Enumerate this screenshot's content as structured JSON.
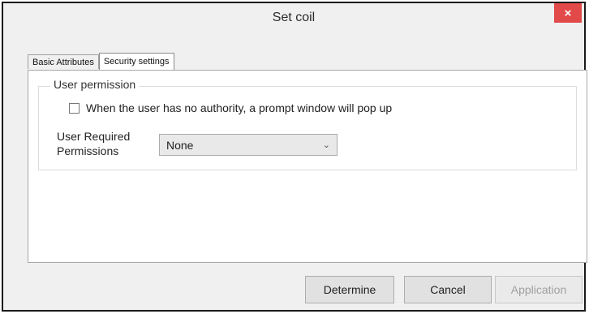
{
  "window": {
    "title": "Set coil",
    "close_symbol": "×"
  },
  "tabs": [
    {
      "label": "Basic Attributes",
      "active": false
    },
    {
      "label": "Security settings",
      "active": true
    }
  ],
  "security": {
    "group_title": "User permission",
    "checkbox": {
      "label": "When the user has no authority, a prompt window will pop up",
      "checked": false
    },
    "required_permissions": {
      "label": "User Required Permissions",
      "value": "None"
    }
  },
  "buttons": {
    "determine": "Determine",
    "cancel": "Cancel",
    "application": "Application"
  },
  "colors": {
    "close_button": "#e24a4a",
    "window_bg": "#f0f0f0"
  }
}
